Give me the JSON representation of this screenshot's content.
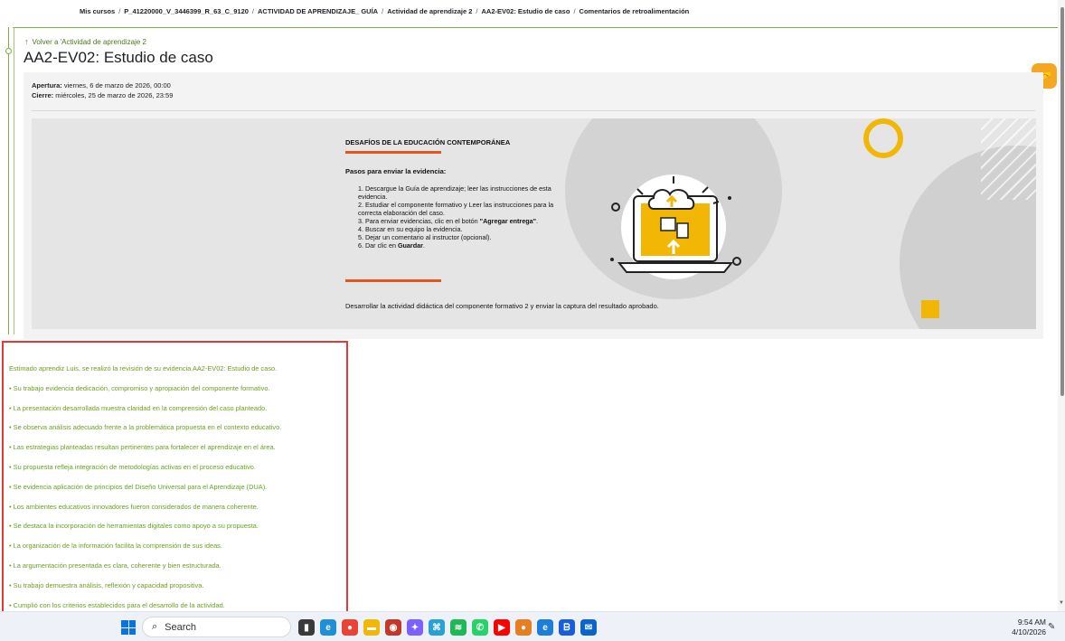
{
  "breadcrumb": {
    "items": [
      "Mis cursos",
      "P_41220000_V_3446399_R_63_C_9120",
      "ACTIVIDAD DE APRENDIZAJE_ GUÍA",
      "Actividad de aprendizaje 2",
      "AA2-EV02: Estudio de caso",
      "Comentarios de retroalimentación"
    ],
    "separator": "/"
  },
  "back_link": {
    "label": "Volver a 'Actividad de aprendizaje 2",
    "icon": "arrow-up-icon"
  },
  "page_title": "AA2-EV02: Estudio de caso",
  "helper_button": {
    "icon": "handshake-icon",
    "color": "#f5a623"
  },
  "dates": {
    "opening_label": "Apertura:",
    "opening_value": "viernes, 6 de marzo de 2026, 00:00",
    "closing_label": "Cierre:",
    "closing_value": "miércoles, 25 de marzo de 2026, 23:59"
  },
  "banner": {
    "title": "DESAFÍOS DE LA EDUCACIÓN CONTEMPORÁNEA",
    "steps_title": "Pasos para enviar la evidencia:",
    "steps": [
      {
        "text": "1. Descargue la Guía de aprendizaje; leer las instrucciones de esta evidencia."
      },
      {
        "text": "2. Estudiar el componente formativo y Leer las instrucciones para la correcta elaboración del caso."
      },
      {
        "text_before": "3. Para enviar evidencias, clic en el botón ",
        "bold": "\"Agregar entrega\"",
        "text_after": "."
      },
      {
        "text": "4. Buscar en su equipo la evidencia."
      },
      {
        "text": "5. Dejar un comentario al instructor (opcional)."
      },
      {
        "text_before": "6. Dar clic en ",
        "bold": "Guardar",
        "text_after": "."
      }
    ],
    "footer": "Desarrollar la actividad didáctica del componente formativo 2 y enviar la captura del resultado aprobado.",
    "accent_color": "#f2b705",
    "underline_color": "#e3551f",
    "illustration_icon": "laptop-cloud-upload-icon"
  },
  "feedback": {
    "color": "#6aa121",
    "lines": [
      "Estimado aprendiz Luis, se realizó la revisión de su evidencia AA2-EV02: Estudio de caso.",
      "• Su trabajo evidencia dedicación, compromiso y apropiación del componente formativo.",
      "• La presentación desarrollada muestra claridad en la comprensión del caso planteado.",
      "• Se observa análisis adecuado frente a la problemática propuesta en el contexto educativo.",
      "• Las estrategias planteadas resultan pertinentes para fortalecer el aprendizaje en el área.",
      "• Su propuesta refleja integración de metodologías activas en el proceso educativo.",
      "• Se evidencia aplicación de principios del Diseño Universal para el Aprendizaje (DUA).",
      "• Los ambientes educativos innovadores fueron considerados de manera coherente.",
      "• Se destaca la incorporación de herramientas digitales como apoyo a su propuesta.",
      "• La organización de la información facilita la comprensión de sus ideas.",
      "• La argumentación presentada es clara, coherente y bien estructurada.",
      "• Su trabajo demuestra análisis, reflexión y capacidad propositiva.",
      "• Cumplió con los criterios establecidos para el desarrollo de la actividad."
    ]
  },
  "taskbar": {
    "search_placeholder": "Search",
    "time": "9:54 AM",
    "date": "4/10/2026",
    "apps": [
      {
        "name": "task-view",
        "color": "#3a3a3a",
        "glyph": "▮"
      },
      {
        "name": "edge",
        "color": "#1f8fd6",
        "glyph": "e"
      },
      {
        "name": "chrome",
        "color": "#ea4335",
        "glyph": "●"
      },
      {
        "name": "file-explorer",
        "color": "#f2b705",
        "glyph": "▬"
      },
      {
        "name": "baseball-app",
        "color": "#c0392b",
        "glyph": "◉"
      },
      {
        "name": "copilot",
        "color": "#7b61ff",
        "glyph": "✦"
      },
      {
        "name": "network-app",
        "color": "#2aa1d6",
        "glyph": "⌘"
      },
      {
        "name": "spotify",
        "color": "#1db954",
        "glyph": "≋"
      },
      {
        "name": "whatsapp",
        "color": "#25d366",
        "glyph": "✆"
      },
      {
        "name": "youtube",
        "color": "#ff0000",
        "glyph": "▶"
      },
      {
        "name": "chrome-profile",
        "color": "#e67e22",
        "glyph": "●"
      },
      {
        "name": "edge-profile",
        "color": "#1c7ed6",
        "glyph": "e"
      },
      {
        "name": "bitwarden",
        "color": "#175ddc",
        "glyph": "ᗷ"
      },
      {
        "name": "outlook",
        "color": "#0a64c9",
        "glyph": "✉"
      }
    ]
  }
}
